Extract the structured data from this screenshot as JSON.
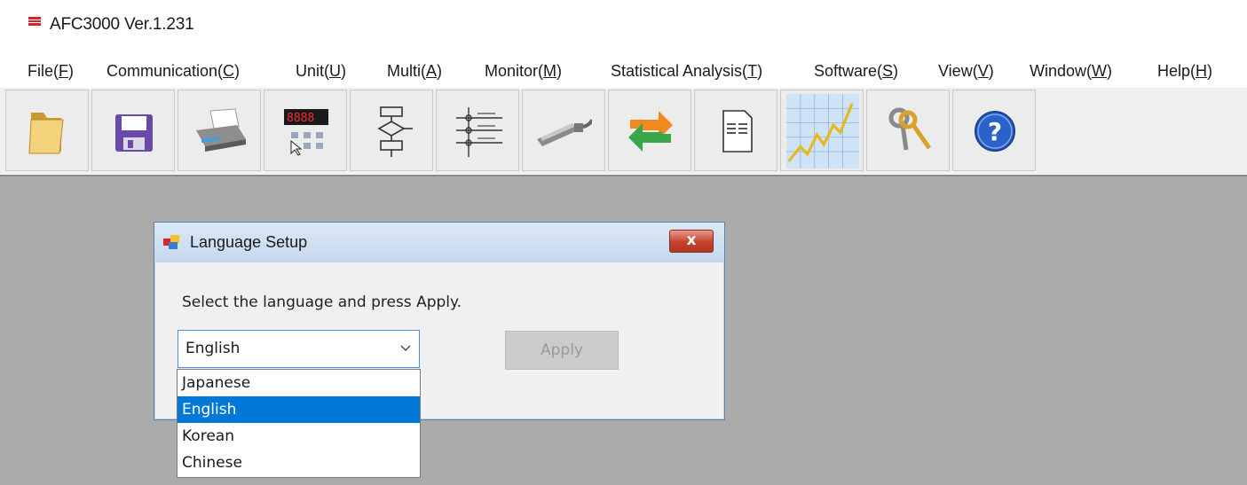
{
  "window": {
    "title": "AFC3000 Ver.1.231",
    "logo_icon": "afc-logo-icon"
  },
  "menu": [
    {
      "label": "File(",
      "key": "F",
      "end": ")"
    },
    {
      "label": "Communication(",
      "key": "C",
      "end": ")"
    },
    {
      "label": "Unit(",
      "key": "U",
      "end": ")"
    },
    {
      "label": "Multi(",
      "key": "A",
      "end": ")"
    },
    {
      "label": "Monitor(",
      "key": "M",
      "end": ")"
    },
    {
      "label": "Statistical Analysis(",
      "key": "T",
      "end": ")"
    },
    {
      "label": "Software(",
      "key": "S",
      "end": ")"
    },
    {
      "label": "View(",
      "key": "V",
      "end": ")"
    },
    {
      "label": "Window(",
      "key": "W",
      "end": ")"
    },
    {
      "label": "Help(",
      "key": "H",
      "end": ")"
    }
  ],
  "toolbar": {
    "buttons": [
      {
        "icon": "folder-open-icon"
      },
      {
        "icon": "save-disk-icon"
      },
      {
        "icon": "printer-icon"
      },
      {
        "icon": "unit-display-icon"
      },
      {
        "icon": "flowchart-icon"
      },
      {
        "icon": "sequence-list-icon"
      },
      {
        "icon": "serial-cable-icon"
      },
      {
        "icon": "sync-arrows-icon"
      },
      {
        "icon": "document-icon"
      },
      {
        "icon": "graph-chart-icon"
      },
      {
        "icon": "keys-icon"
      },
      {
        "icon": "help-question-icon"
      }
    ]
  },
  "dialog": {
    "title": "Language Setup",
    "close_label": "x",
    "message": "Select the language and press Apply.",
    "combo_value": "English",
    "apply_label": "Apply",
    "options": [
      "Japanese",
      "English",
      "Korean",
      "Chinese"
    ],
    "selected_index": 1
  },
  "colors": {
    "workspace": "#ababab",
    "selection": "#0078d7",
    "dialog_title": "#c4d8ee",
    "close_button": "#c4412e"
  }
}
